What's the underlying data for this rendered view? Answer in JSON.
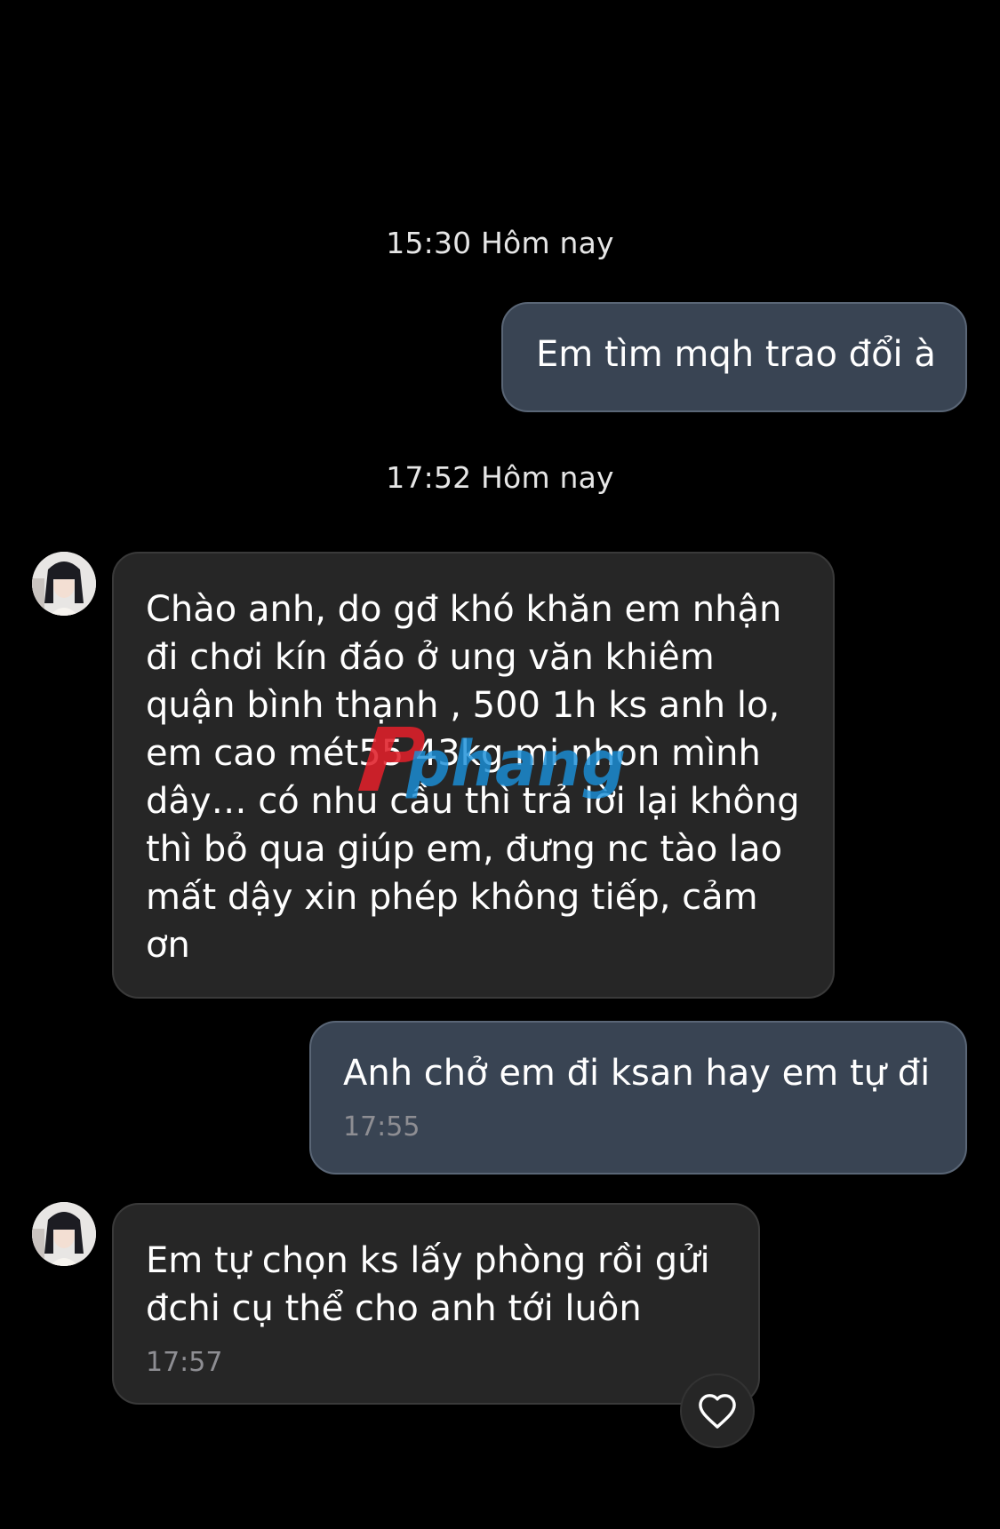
{
  "timestamps": [
    "15:30 Hôm nay",
    "17:52 Hôm nay"
  ],
  "messages": [
    {
      "direction": "outgoing",
      "text": "Em tìm mqh trao đổi à"
    },
    {
      "direction": "incoming",
      "text": "Chào anh, do gđ khó khăn em nhận\nđi chơi kín đáo ở ung văn khiêm\nquận bình thạnh , 500 1h ks anh lo,\nem cao mét55 43kg mi nhon mình\ndây… có nhu cầu thì trả lời lại không\nthì bỏ qua giúp em, đưng nc tào lao\nmất dậy xin phép không tiếp, cảm\nơn"
    },
    {
      "direction": "outgoing",
      "text": "Anh chở em đi ksan hay em tự đi",
      "time": "17:55"
    },
    {
      "direction": "incoming",
      "text": "Em tự chọn ks lấy phòng rồi gửi\nđchi cụ thể cho anh tới luôn",
      "time": "17:57"
    }
  ],
  "watermark": {
    "text": "phang",
    "colors": [
      "#e0202a",
      "#1a8fd8"
    ]
  },
  "icons": {
    "like": "heart-outline-icon",
    "avatar": "contact-avatar"
  },
  "colors": {
    "background": "#000000",
    "outgoing_bubble": "#394453",
    "incoming_bubble": "#262626",
    "meta_text": "#8e8e93"
  }
}
